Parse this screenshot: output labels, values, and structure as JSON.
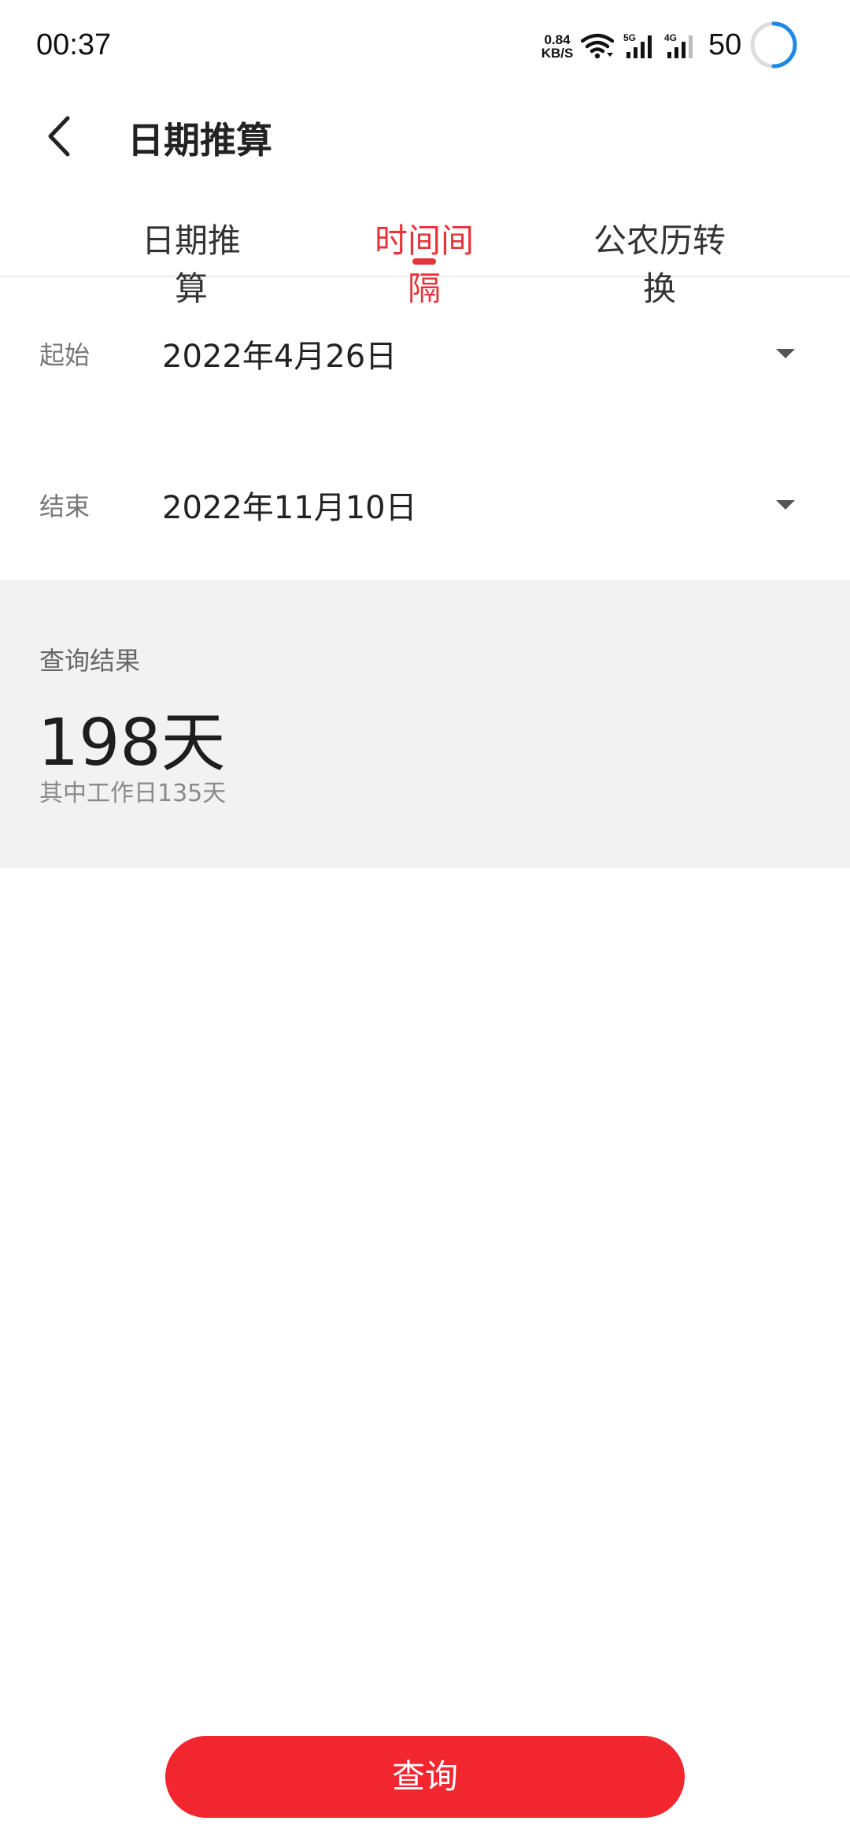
{
  "status_bar": {
    "time": "00:37",
    "net_speed_value": "0.84",
    "net_speed_unit": "KB/S",
    "signal_5g_label": "5G",
    "signal_4g_label": "4G",
    "battery": "50",
    "battery_ring_color": "#1e88e5"
  },
  "header": {
    "title": "日期推算"
  },
  "tabs": [
    {
      "label": "日期推算",
      "active": false
    },
    {
      "label": "时间间隔",
      "active": true
    },
    {
      "label": "公农历转换",
      "active": false
    }
  ],
  "form": {
    "start": {
      "label": "起始",
      "value": "2022年4月26日"
    },
    "end": {
      "label": "结束",
      "value": "2022年11月10日"
    }
  },
  "result": {
    "title": "查询结果",
    "days": "198天",
    "workdays": "其中工作日135天"
  },
  "actions": {
    "query_label": "查询"
  },
  "colors": {
    "accent": "#e8333b",
    "button": "#f2262e",
    "panel_bg": "#f2f2f2"
  }
}
